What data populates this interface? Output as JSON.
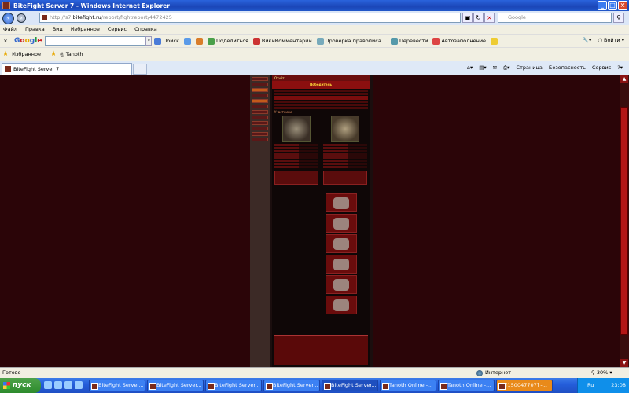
{
  "window": {
    "title": "BiteFight Server 7 - Windows Internet Explorer"
  },
  "address": {
    "prefix": "http://s7.",
    "host": "bitefight.ru",
    "path": "/report/fightreport/4472425"
  },
  "search": {
    "placeholder": "Google"
  },
  "menu": [
    "Файл",
    "Правка",
    "Вид",
    "Избранное",
    "Сервис",
    "Справка"
  ],
  "gtoolbar": {
    "logo": "Google",
    "items": [
      "Поиск",
      "Поделиться",
      "ВикиКомментарии",
      "Проверка правописа...",
      "Перевести",
      "Автозаполнение"
    ],
    "settings": "Войти"
  },
  "favorites": {
    "label": "Избранное",
    "link": "Tanoth"
  },
  "tab": {
    "label": "BiteFight Server 7"
  },
  "commandbar": [
    "Страница",
    "Безопасность",
    "Сервис"
  ],
  "game": {
    "header": "Отчёт",
    "banner": "Победитель",
    "section": "Участники"
  },
  "status": {
    "left": "Готово",
    "zone": "Интернет",
    "zoom": "30%"
  },
  "taskbar": {
    "start": "пуск",
    "tasks": [
      "BiteFight Server...",
      "BiteFight Server...",
      "BiteFight Server...",
      "BiteFight Server...",
      "BiteFight Server...",
      "Tanoth Online -...",
      "Tanoth Online -...",
      "[150047707] -..."
    ],
    "lang": "Ru",
    "clock": "23:08"
  }
}
